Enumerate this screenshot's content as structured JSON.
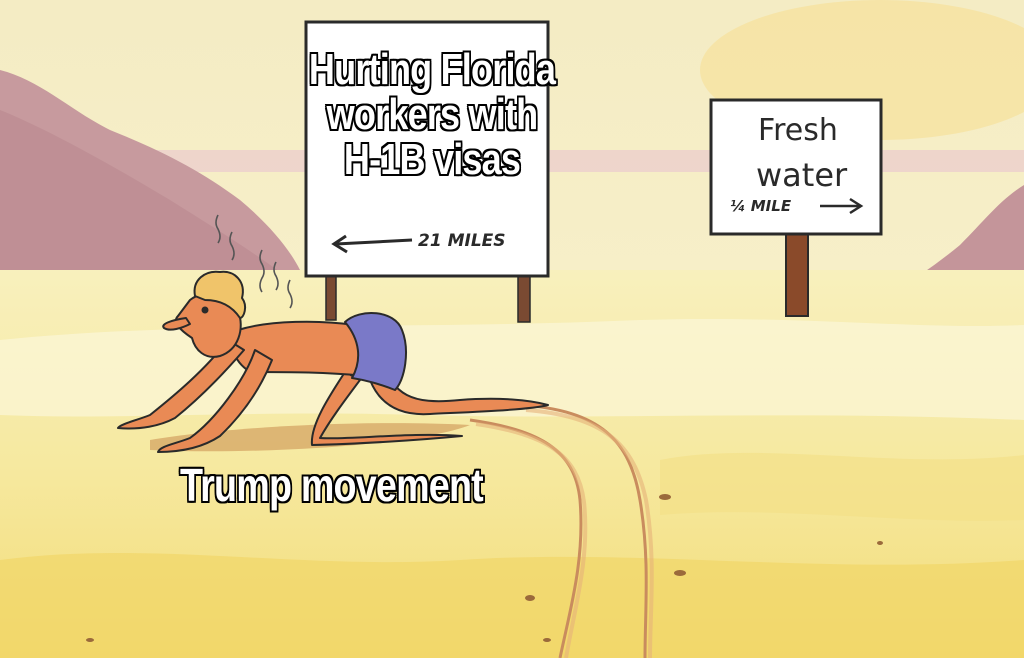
{
  "meme": {
    "caption_top_lines": [
      "Hurting Florida",
      "workers with",
      "H-1B visas"
    ],
    "caption_bottom": "Trump movement"
  },
  "left_sign": {
    "distance_text": "21 MILES"
  },
  "right_sign": {
    "line1": "Fresh",
    "line2": "water",
    "distance_text": "¼ MILE"
  },
  "colors": {
    "sand": "#f7eda8",
    "sky": "#f6f0c8",
    "mountains": "#c79a9e",
    "skin": "#e98a55",
    "shorts": "#7a79c8",
    "sign_face": "#ffffff",
    "post": "#8a4a2a"
  }
}
